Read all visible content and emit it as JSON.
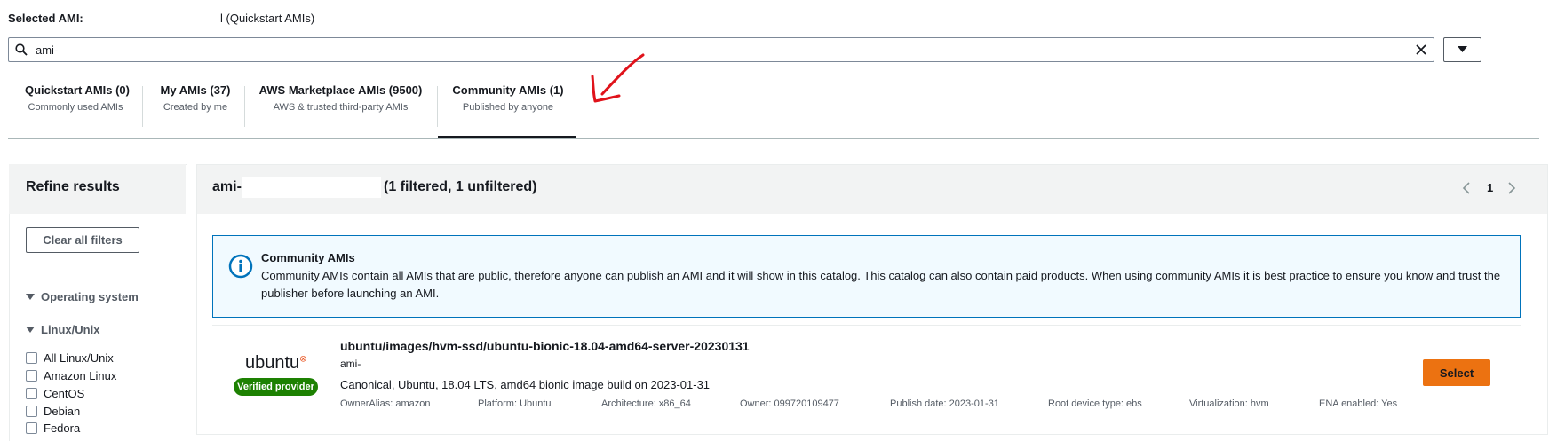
{
  "selected_ami": {
    "label": "Selected AMI:",
    "value": "l (Quickstart AMIs)"
  },
  "search": {
    "value": "ami-",
    "icon": "search-icon",
    "clear_icon": "close-icon",
    "dropdown_icon": "caret-down-icon"
  },
  "tabs": [
    {
      "title": "Quickstart AMIs (0)",
      "subtitle": "Commonly used AMIs",
      "active": false
    },
    {
      "title": "My AMIs (37)",
      "subtitle": "Created by me",
      "active": false
    },
    {
      "title": "AWS Marketplace AMIs (9500)",
      "subtitle": "AWS & trusted third-party AMIs",
      "active": false
    },
    {
      "title": "Community AMIs (1)",
      "subtitle": "Published by anyone",
      "active": true
    }
  ],
  "annotation": {
    "icon": "red-arrow-annotation",
    "color": "#e0131b"
  },
  "sidebar": {
    "title": "Refine results",
    "clear_button": "Clear all filters",
    "groups": [
      {
        "label": "Operating system"
      },
      {
        "label": "Linux/Unix"
      }
    ],
    "options": [
      "All Linux/Unix",
      "Amazon Linux",
      "CentOS",
      "Debian",
      "Fedora"
    ]
  },
  "results": {
    "query_prefix": "ami-",
    "count_text": "(1 filtered, 1 unfiltered)",
    "page": "1"
  },
  "alert": {
    "icon": "info-icon",
    "title": "Community AMIs",
    "body": "Community AMIs contain all AMIs that are public, therefore anyone can publish an AMI and it will show in this catalog. This catalog can also contain paid products. When using community AMIs it is best practice to ensure you know and trust the publisher before launching an AMI."
  },
  "ami": {
    "logo_text": "ubuntu",
    "badge": "Verified provider",
    "name": "ubuntu/images/hvm-ssd/ubuntu-bionic-18.04-amd64-server-20230131",
    "id": "ami-",
    "description": "Canonical, Ubuntu, 18.04 LTS, amd64 bionic image build on 2023-01-31",
    "meta": {
      "owner_alias": "OwnerAlias: amazon",
      "platform": "Platform: Ubuntu",
      "architecture": "Architecture: x86_64",
      "owner": "Owner: 099720109477",
      "publish_date": "Publish date: 2023-01-31",
      "root_device": "Root device type: ebs",
      "virtualization": "Virtualization: hvm",
      "ena": "ENA enabled: Yes"
    },
    "select_label": "Select"
  },
  "colors": {
    "accent_orange": "#ec7211",
    "verified_green": "#1d8102",
    "info_blue": "#0073bb",
    "text_dark": "#16191f"
  }
}
